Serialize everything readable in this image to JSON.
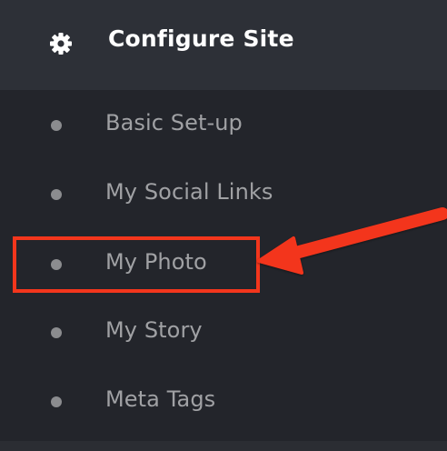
{
  "header": {
    "title": "Configure Site",
    "icon": "gear-icon"
  },
  "menu": {
    "items": [
      {
        "label": "Basic Set-up"
      },
      {
        "label": "My Social Links"
      },
      {
        "label": "My Photo"
      },
      {
        "label": "My Story"
      },
      {
        "label": "Meta Tags"
      }
    ]
  },
  "annotation": {
    "highlighted_item": "My Photo",
    "color": "#f3361c"
  }
}
